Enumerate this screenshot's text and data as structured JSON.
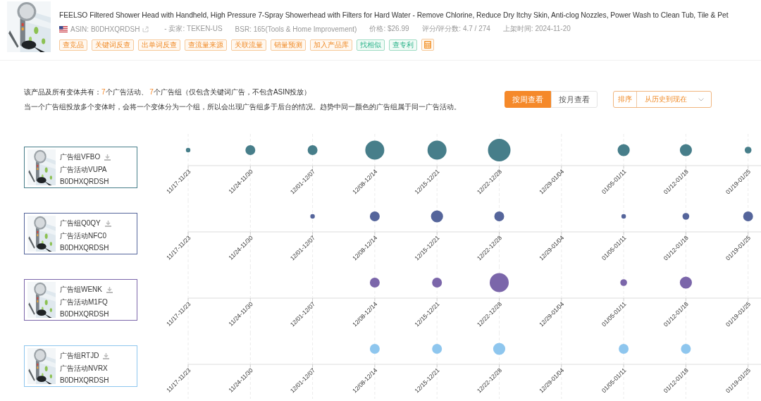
{
  "product": {
    "title": "FEELSO Filtered Shower Head with Handheld, High Pressure 7-Spray Showerhead with Filters for Hard Water - Remove Chlorine, Reduce Dry Itchy Skin, Anti-clog Nozzles, Power Wash to Clean Tub, Tile & Pet",
    "asin": "ASIN: B0DHXQRDSH",
    "details": [
      "- 卖家: TEKEN-US",
      "BSR: 165(Tools & Home Improvement)",
      "价格: $26.99",
      "评分/评分数: 4.7 / 274",
      "上架时间: 2024-11-20"
    ],
    "tags": [
      {
        "label": "查竞品",
        "kind": "warm"
      },
      {
        "label": "关键词反查",
        "kind": "warm"
      },
      {
        "label": "出单词反查",
        "kind": "warm"
      },
      {
        "label": "查流量来源",
        "kind": "warm"
      },
      {
        "label": "关联流量",
        "kind": "warm"
      },
      {
        "label": "销量预测",
        "kind": "warm"
      },
      {
        "label": "加入产品库",
        "kind": "warm"
      },
      {
        "label": "找相似",
        "kind": "green"
      },
      {
        "label": "查专利",
        "kind": "green"
      },
      {
        "kind": "calculator"
      }
    ]
  },
  "notice": [
    [
      {
        "text": "该产品及所有变体共有：",
        "highlight": false
      },
      {
        "text": "7",
        "highlight": true
      },
      {
        "text": "个广告活动、 ",
        "highlight": false
      },
      {
        "text": "7",
        "highlight": true
      },
      {
        "text": "个广告组（仅包含关键词广告，不包含ASIN投放）",
        "highlight": false
      }
    ],
    [
      {
        "text": "当一个广告组投放多个变体时，会将一个变体分为一个组，所以会出现广告组多于后台的情况。趋势中同一颜色的广告组属于同一广告活动。",
        "highlight": false
      }
    ]
  ],
  "view_tabs": [
    {
      "label": "按周查看",
      "selected": true
    },
    {
      "label": "按月查看",
      "selected": false
    }
  ],
  "sort": {
    "label": "排序",
    "value": "从历史到现在"
  },
  "rows": [
    {
      "ad_group": "广告组VFBO",
      "campaign": "广告活动VUPA",
      "asin": "B0DHXQRDSH",
      "color": "#477e8a",
      "weeks": [
        {
          "label": "11/17-11/23",
          "kind": "tiny"
        },
        {
          "label": "11/24-11/30",
          "kind": "medium"
        },
        {
          "label": "12/01-12/07",
          "kind": "medium"
        },
        {
          "label": "12/08-12/14",
          "kind": "huge"
        },
        {
          "label": "12/15-12/21",
          "kind": "huge"
        },
        {
          "label": "12/22-12/28",
          "kind": "giant"
        },
        {
          "label": "12/29-01/04",
          "kind": "none"
        },
        {
          "label": "01/05-01/11",
          "kind": "large"
        },
        {
          "label": "01/12-01/18",
          "kind": "large"
        },
        {
          "label": "01/19-01/25",
          "kind": "small"
        }
      ]
    },
    {
      "ad_group": "广告组Q0QY",
      "campaign": "广告活动NFC0",
      "asin": "B0DHXQRDSH",
      "color": "#55659b",
      "weeks": [
        {
          "label": "11/17-11/23",
          "kind": "none"
        },
        {
          "label": "11/24-11/30",
          "kind": "none"
        },
        {
          "label": "12/01-12/07",
          "kind": "tiny"
        },
        {
          "label": "12/08-12/14",
          "kind": "medium"
        },
        {
          "label": "12/15-12/21",
          "kind": "large"
        },
        {
          "label": "12/22-12/28",
          "kind": "medium"
        },
        {
          "label": "12/29-01/04",
          "kind": "none"
        },
        {
          "label": "01/05-01/11",
          "kind": "tiny"
        },
        {
          "label": "01/12-01/18",
          "kind": "small"
        },
        {
          "label": "01/19-01/25",
          "kind": "medium"
        }
      ]
    },
    {
      "ad_group": "广告组WENK",
      "campaign": "广告活动M1FQ",
      "asin": "B0DHXQRDSH",
      "color": "#7b66aa",
      "weeks": [
        {
          "label": "11/17-11/23",
          "kind": "none"
        },
        {
          "label": "11/24-11/30",
          "kind": "none"
        },
        {
          "label": "12/01-12/07",
          "kind": "none"
        },
        {
          "label": "12/08-12/14",
          "kind": "medium"
        },
        {
          "label": "12/15-12/21",
          "kind": "medium"
        },
        {
          "label": "12/22-12/28",
          "kind": "huge"
        },
        {
          "label": "12/29-01/04",
          "kind": "none"
        },
        {
          "label": "01/05-01/11",
          "kind": "small"
        },
        {
          "label": "01/12-01/18",
          "kind": "large"
        },
        {
          "label": "01/19-01/25",
          "kind": "none"
        }
      ]
    },
    {
      "ad_group": "广告组RTJD",
      "campaign": "广告活动NVRX",
      "asin": "B0DHXQRDSH",
      "color": "#8ec6ee",
      "weeks": [
        {
          "label": "11/17-11/23",
          "kind": "none"
        },
        {
          "label": "11/24-11/30",
          "kind": "none"
        },
        {
          "label": "12/01-12/07",
          "kind": "none"
        },
        {
          "label": "12/08-12/14",
          "kind": "medium"
        },
        {
          "label": "12/15-12/21",
          "kind": "medium"
        },
        {
          "label": "12/22-12/28",
          "kind": "large"
        },
        {
          "label": "12/29-01/04",
          "kind": "none"
        },
        {
          "label": "01/05-01/11",
          "kind": "medium"
        },
        {
          "label": "01/12-01/18",
          "kind": "medium"
        },
        {
          "label": "01/19-01/25",
          "kind": "none"
        }
      ]
    }
  ]
}
